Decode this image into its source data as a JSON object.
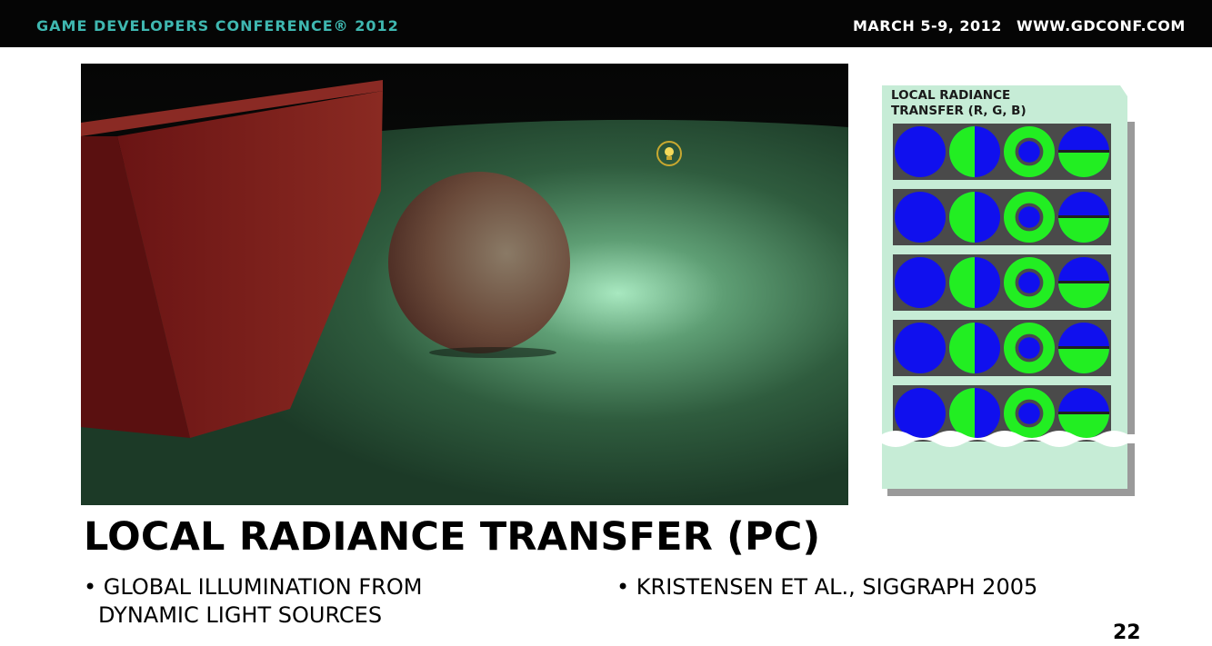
{
  "header": {
    "conference": "GAME DEVELOPERS CONFERENCE® 2012",
    "dates": "MARCH 5-9, 2012",
    "url": "WWW.GDCONF.COM"
  },
  "panel": {
    "label": "LOCAL RADIANCE\nTRANSFER (R, G, B)",
    "row_count": 5,
    "cell_patterns": [
      "blue-disc",
      "half-green-left",
      "green-ring",
      "half-green-bottom"
    ],
    "colors": {
      "blue": "#1010ee",
      "green": "#22ee22",
      "panel_bg": "#c6ecd6"
    }
  },
  "render": {
    "light-icon": "lightbulb-icon",
    "colors": {
      "floor": "#2d5a3c",
      "wall": "#7a1c1c",
      "sphere": "#6a5a4a"
    }
  },
  "slide": {
    "title": "LOCAL RADIANCE TRANSFER (PC)",
    "bullet1_line1": "• GLOBAL ILLUMINATION FROM",
    "bullet1_line2": "DYNAMIC LIGHT SOURCES",
    "bullet2": "• KRISTENSEN ET AL., SIGGRAPH 2005",
    "page_number": "22"
  }
}
